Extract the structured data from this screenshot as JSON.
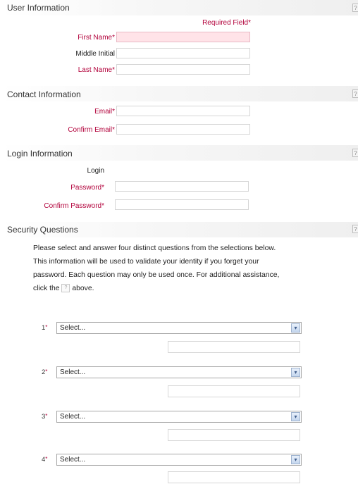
{
  "sections": {
    "user_info": "User Information",
    "contact_info": "Contact Information",
    "login_info": "Login Information",
    "security_questions": "Security Questions"
  },
  "help_glyph": "?",
  "required_note": "Required Field*",
  "fields": {
    "first_name": "First Name*",
    "middle_initial": "Middle Initial",
    "last_name": "Last Name*",
    "email": "Email*",
    "confirm_email": "Confirm Email*",
    "login": "Login",
    "password": "Password*",
    "confirm_password": "Confirm Password*"
  },
  "security": {
    "intro_1": "Please select and answer four distinct questions from the selections below.",
    "intro_2": "This information will be used to validate your identity if you forget your",
    "intro_3": "password. Each question may only be used once. For additional assistance,",
    "intro_4_before": "click the",
    "intro_4_after": "above.",
    "questions": [
      {
        "num": "1",
        "star": "*",
        "selected": "Select..."
      },
      {
        "num": "2",
        "star": "*",
        "selected": "Select..."
      },
      {
        "num": "3",
        "star": "*",
        "selected": "Select..."
      },
      {
        "num": "4",
        "star": "*",
        "selected": "Select..."
      }
    ],
    "dropdown_glyph": "▾"
  },
  "colors": {
    "required": "#b2003a",
    "invalid_field": "#ffe3e8"
  }
}
